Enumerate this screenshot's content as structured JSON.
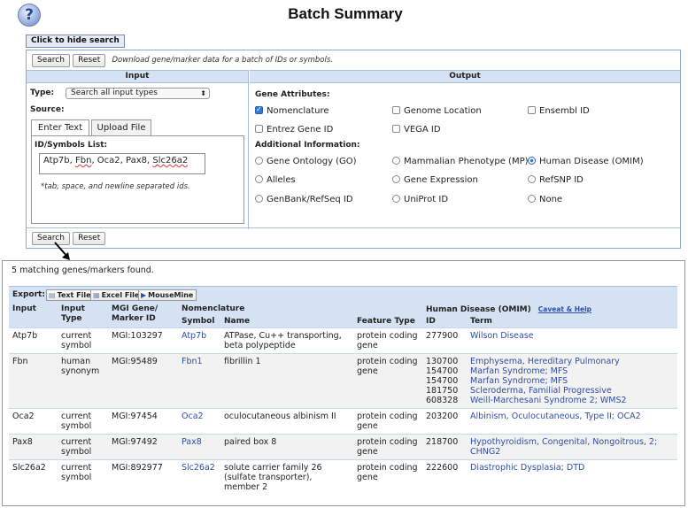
{
  "header": {
    "title": "Batch Summary",
    "help_glyph": "?"
  },
  "search_form": {
    "hide_button": "Click to hide search",
    "search_label": "Search",
    "reset_label": "Reset",
    "hint": "Download gene/marker data for a batch of IDs or symbols.",
    "input_header": "Input",
    "output_header": "Output",
    "type_label": "Type:",
    "type_value": "Search all input types",
    "source_label": "Source:",
    "tabs": [
      "Enter Text",
      "Upload File"
    ],
    "ids_label": "ID/Symbols List:",
    "ids_value_plain": "Atp7b, ",
    "ids_value_sq1": "Fbn",
    "ids_value_mid": ", Oca2, Pax8, ",
    "ids_value_sq2": "Slc26a2",
    "ids_note": "*tab, space, and newline separated ids.",
    "gene_attributes_label": "Gene Attributes:",
    "gene_attributes": [
      {
        "label": "Nomenclature",
        "checked": true
      },
      {
        "label": "Genome Location",
        "checked": false
      },
      {
        "label": "Ensembl ID",
        "checked": false
      },
      {
        "label": "Entrez Gene ID",
        "checked": false
      },
      {
        "label": "VEGA ID",
        "checked": false
      }
    ],
    "additional_label": "Additional Information:",
    "additional": [
      {
        "label": "Gene Ontology (GO)",
        "selected": false
      },
      {
        "label": "Mammalian Phenotype (MP)",
        "selected": false
      },
      {
        "label": "Human Disease (OMIM)",
        "selected": true
      },
      {
        "label": "Alleles",
        "selected": false
      },
      {
        "label": "Gene Expression",
        "selected": false
      },
      {
        "label": "RefSNP ID",
        "selected": false
      },
      {
        "label": "GenBank/RefSeq ID",
        "selected": false
      },
      {
        "label": "UniProt ID",
        "selected": false
      },
      {
        "label": "None",
        "selected": false
      }
    ]
  },
  "results": {
    "found_text": "5 matching genes/markers found.",
    "export_label": "Export:",
    "export_buttons": [
      "Text File",
      "Excel File",
      "MouseMine"
    ],
    "headers": {
      "input": "Input",
      "input_type_1": "Input",
      "input_type_2": "Type",
      "mgi_1": "MGI Gene/",
      "mgi_2": "Marker ID",
      "nomenclature": "Nomenclature",
      "symbol": "Symbol",
      "name": "Name",
      "feature_type": "Feature Type",
      "human_disease": "Human Disease (OMIM)",
      "caveat": "Caveat & Help",
      "id": "ID",
      "term": "Term"
    },
    "rows": [
      {
        "input": "Atp7b",
        "type": "current symbol",
        "mgi": "MGI:103297",
        "symbol": "Atp7b",
        "name": "ATPase, Cu++ transporting, beta polypeptide",
        "feature": "protein coding gene",
        "ids": [
          "277900"
        ],
        "terms": [
          "Wilson Disease"
        ]
      },
      {
        "input": "Fbn",
        "type": "human synonym",
        "mgi": "MGI:95489",
        "symbol": "Fbn1",
        "name": "fibrillin 1",
        "feature": "protein coding gene",
        "ids": [
          "130700",
          "154700",
          "154700",
          "181750",
          "608328"
        ],
        "terms": [
          "Emphysema, Hereditary Pulmonary",
          "Marfan Syndrome; MFS",
          "Marfan Syndrome; MFS",
          "Scleroderma, Familial Progressive",
          "Weill-Marchesani Syndrome 2; WMS2"
        ]
      },
      {
        "input": "Oca2",
        "type": "current symbol",
        "mgi": "MGI:97454",
        "symbol": "Oca2",
        "name": "oculocutaneous albinism II",
        "feature": "protein coding gene",
        "ids": [
          "203200"
        ],
        "terms": [
          "Albinism, Oculocutaneous, Type II; OCA2"
        ]
      },
      {
        "input": "Pax8",
        "type": "current symbol",
        "mgi": "MGI:97492",
        "symbol": "Pax8",
        "name": "paired box 8",
        "feature": "protein coding gene",
        "ids": [
          "218700"
        ],
        "terms": [
          "Hypothyroidism, Congenital, Nongoitrous, 2; CHNG2"
        ]
      },
      {
        "input": "Slc26a2",
        "type": "current symbol",
        "mgi": "MGI:892977",
        "symbol": "Slc26a2",
        "name": "solute carrier family 26 (sulfate transporter), member 2",
        "feature": "protein coding gene",
        "ids": [
          "222600"
        ],
        "terms": [
          "Diastrophic Dysplasia; DTD"
        ]
      }
    ]
  }
}
